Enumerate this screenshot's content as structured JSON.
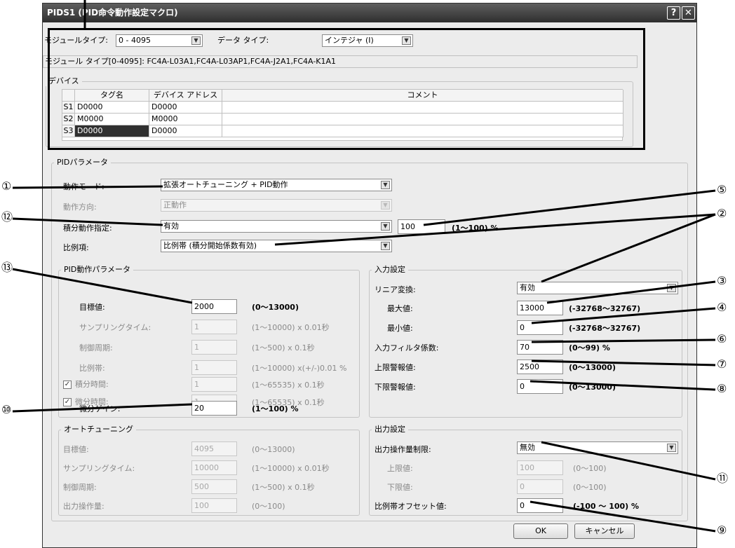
{
  "window": {
    "title": "PIDS1 (PID命令動作設定マクロ)",
    "help": "?",
    "close": "✕"
  },
  "module": {
    "label": "モジュールタイプ:",
    "value": "0 - 4095",
    "data_type_label": "データ タイプ:",
    "data_type_value": "インテジャ (I)",
    "info": "モジュール タイプ[0-4095]: FC4A-L03A1,FC4A-L03AP1,FC4A-J2A1,FC4A-K1A1"
  },
  "device": {
    "label": "デバイス",
    "columns": [
      "タグ名",
      "デバイス アドレス",
      "コメント"
    ],
    "rows": [
      {
        "id": "S1",
        "tag": "D0000",
        "addr": "D0000",
        "comment": ""
      },
      {
        "id": "S2",
        "tag": "M0000",
        "addr": "M0000",
        "comment": ""
      },
      {
        "id": "S3",
        "tag": "D0000",
        "addr": "D0000",
        "comment": ""
      }
    ]
  },
  "pid": {
    "label": "PIDパラメータ",
    "mode_label": "動作モード:",
    "mode_value": "拡張オートチューニング + PID動作",
    "dir_label": "動作方向:",
    "dir_value": "正動作",
    "integral_label": "積分動作指定:",
    "integral_value": "有効",
    "integral_num": "100",
    "integral_range": "(1～100) %",
    "prop_label": "比例項:",
    "prop_value": "比例帯 (積分開始係数有効)"
  },
  "pid_op": {
    "label": "PID動作パラメータ",
    "rows": [
      {
        "label": "目標値:",
        "value": "2000",
        "range": "(0～13000)"
      },
      {
        "label": "サンプリングタイム:",
        "value": "1",
        "range": "(1～10000) x 0.01秒"
      },
      {
        "label": "制御周期:",
        "value": "1",
        "range": "(1～500) x 0.1秒"
      },
      {
        "label": "比例帯:",
        "value": "1",
        "range": "(1～10000) x(+/-)0.01 %"
      },
      {
        "label": "積分時間:",
        "value": "1",
        "range": "(1～65535) x 0.1秒"
      },
      {
        "label": "微分時間:",
        "value": "1",
        "range": "(1～65535) x 0.1秒"
      },
      {
        "label": "微分ゲイン:",
        "value": "20",
        "range": "(1～100) %"
      }
    ]
  },
  "input": {
    "label": "入力設定",
    "linear_label": "リニア変換:",
    "linear_value": "有効",
    "rows": [
      {
        "label": "最大値:",
        "value": "13000",
        "range": "(-32768～32767)"
      },
      {
        "label": "最小値:",
        "value": "0",
        "range": "(-32768～32767)"
      },
      {
        "label": "入力フィルタ係数:",
        "value": "70",
        "range": "(0～99) %"
      },
      {
        "label": "上限警報値:",
        "value": "2500",
        "range": "(0～13000)"
      },
      {
        "label": "下限警報値:",
        "value": "0",
        "range": "(0～13000)"
      }
    ]
  },
  "autotune": {
    "label": "オートチューニング",
    "rows": [
      {
        "label": "目標値:",
        "value": "4095",
        "range": "(0～13000)"
      },
      {
        "label": "サンプリングタイム:",
        "value": "10000",
        "range": "(1～10000) x 0.01秒"
      },
      {
        "label": "制御周期:",
        "value": "500",
        "range": "(1～500) x 0.1秒"
      },
      {
        "label": "出力操作量:",
        "value": "100",
        "range": "(0～100)"
      }
    ]
  },
  "output": {
    "label": "出力設定",
    "limit_label": "出力操作量制限:",
    "limit_value": "無効",
    "rows": [
      {
        "label": "上限値:",
        "value": "100",
        "range": "(0～100)"
      },
      {
        "label": "下限値:",
        "value": "0",
        "range": "(0～100)"
      },
      {
        "label": "比例帯オフセット値:",
        "value": "0",
        "range": "(-100 ～ 100) %"
      }
    ]
  },
  "buttons": {
    "ok": "OK",
    "cancel": "キャンセル"
  },
  "callouts": [
    "①",
    "⑫",
    "⑬",
    "⑩",
    "⑤",
    "②",
    "③",
    "④",
    "⑥",
    "⑦",
    "⑧",
    "⑪",
    "⑨"
  ]
}
